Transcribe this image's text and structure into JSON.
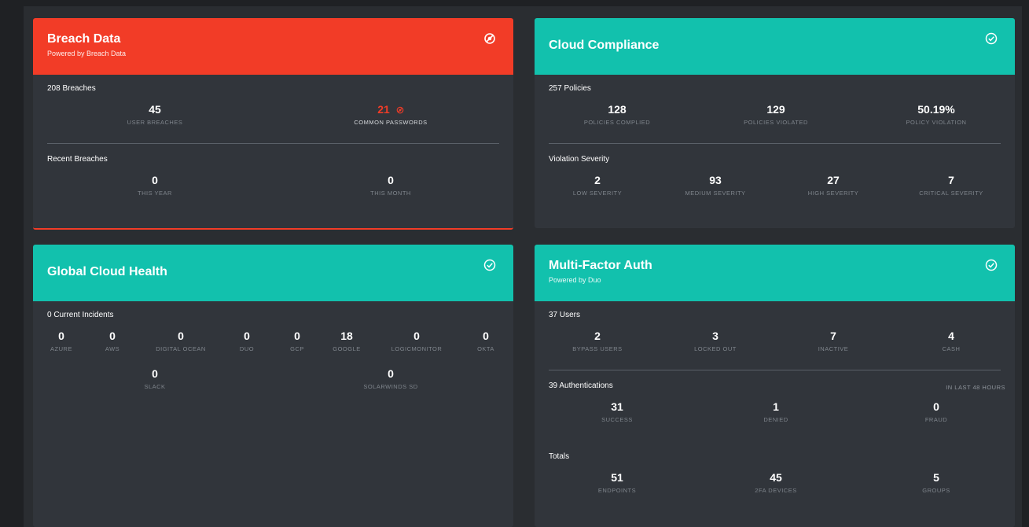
{
  "colors": {
    "breach_accent": "#f23c27",
    "ok_accent": "#12c1ad",
    "card_bg": "#31353b",
    "page_bg": "#1f2124"
  },
  "breach": {
    "title": "Breach Data",
    "subtitle": "Powered by Breach Data",
    "icon": "alert-icon",
    "section1": {
      "label": "208 Breaches",
      "stats": [
        {
          "value": "45",
          "label": "USER BREACHES"
        },
        {
          "value": "21",
          "label": "COMMON PASSWORDS"
        }
      ]
    },
    "section2": {
      "label": "Recent Breaches",
      "stats": [
        {
          "value": "0",
          "label": "THIS YEAR"
        },
        {
          "value": "0",
          "label": "THIS MONTH"
        }
      ]
    }
  },
  "cloud": {
    "title": "Cloud Compliance",
    "icon": "check-circle-icon",
    "section1": {
      "label": "257 Policies",
      "stats": [
        {
          "value": "128",
          "label": "POLICIES COMPLIED"
        },
        {
          "value": "129",
          "label": "POLICIES VIOLATED"
        },
        {
          "value": "50.19%",
          "label": "POLICY VIOLATION"
        }
      ]
    },
    "section2": {
      "label": "Violation Severity",
      "stats": [
        {
          "value": "2",
          "label": "LOW SEVERITY"
        },
        {
          "value": "93",
          "label": "MEDIUM SEVERITY"
        },
        {
          "value": "27",
          "label": "HIGH SEVERITY"
        },
        {
          "value": "7",
          "label": "CRITICAL SEVERITY"
        }
      ]
    }
  },
  "health": {
    "title": "Global Cloud Health",
    "icon": "check-circle-icon",
    "section1": {
      "label": "0 Current Incidents",
      "row1": [
        {
          "value": "0",
          "label": "AZURE"
        },
        {
          "value": "0",
          "label": "AWS"
        },
        {
          "value": "0",
          "label": "DIGITAL OCEAN"
        },
        {
          "value": "0",
          "label": "DUO"
        },
        {
          "value": "0",
          "label": "GCP"
        },
        {
          "value": "18",
          "label": "GOOGLE"
        },
        {
          "value": "0",
          "label": "LOGICMONITOR"
        },
        {
          "value": "0",
          "label": "OKTA"
        }
      ],
      "row2": [
        {
          "value": "0",
          "label": "SLACK"
        },
        {
          "value": "0",
          "label": "SOLARWINDS SD"
        }
      ]
    }
  },
  "mfa": {
    "title": "Multi-Factor Auth",
    "subtitle": "Powered by Duo",
    "icon": "check-circle-icon",
    "section1": {
      "label": "37 Users",
      "stats": [
        {
          "value": "2",
          "label": "BYPASS USERS"
        },
        {
          "value": "3",
          "label": "LOCKED OUT"
        },
        {
          "value": "7",
          "label": "INACTIVE"
        },
        {
          "value": "4",
          "label": "CASH"
        }
      ]
    },
    "section2": {
      "label": "39 Authentications",
      "note": "IN LAST 48 HOURS",
      "stats": [
        {
          "value": "31",
          "label": "SUCCESS"
        },
        {
          "value": "1",
          "label": "DENIED"
        },
        {
          "value": "0",
          "label": "FRAUD"
        }
      ]
    },
    "section3": {
      "label": "Totals",
      "stats": [
        {
          "value": "51",
          "label": "ENDPOINTS"
        },
        {
          "value": "45",
          "label": "2FA DEVICES"
        },
        {
          "value": "5",
          "label": "GROUPS"
        }
      ]
    }
  }
}
